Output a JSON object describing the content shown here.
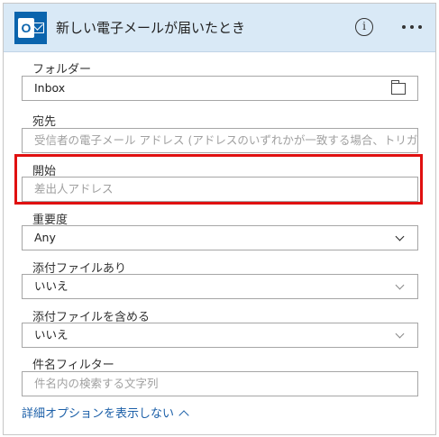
{
  "header": {
    "title": "新しい電子メールが届いたとき",
    "info_icon": "info-icon",
    "more_icon": "more-options-icon",
    "app_icon": "outlook-icon",
    "background": "#d9e9f6"
  },
  "fields": {
    "folder": {
      "label": "フォルダー",
      "value": "Inbox",
      "icon": "folder-icon"
    },
    "to": {
      "label": "宛先",
      "placeholder": "受信者の電子メール アドレス (アドレスのいずれかが一致する場合、トリガ"
    },
    "from": {
      "label": "開始",
      "placeholder": "差出人アドレス"
    },
    "importance": {
      "label": "重要度",
      "value": "Any"
    },
    "has_attachment": {
      "label": "添付ファイルあり",
      "value": "いいえ"
    },
    "include_attachments": {
      "label": "添付ファイルを含める",
      "value": "いいえ"
    },
    "subject_filter": {
      "label": "件名フィルター",
      "placeholder": "件名内の検索する文字列"
    }
  },
  "footer": {
    "toggle_label": "詳細オプションを表示しない"
  },
  "highlight_color": "#e01010",
  "link_color": "#1b5fa8"
}
